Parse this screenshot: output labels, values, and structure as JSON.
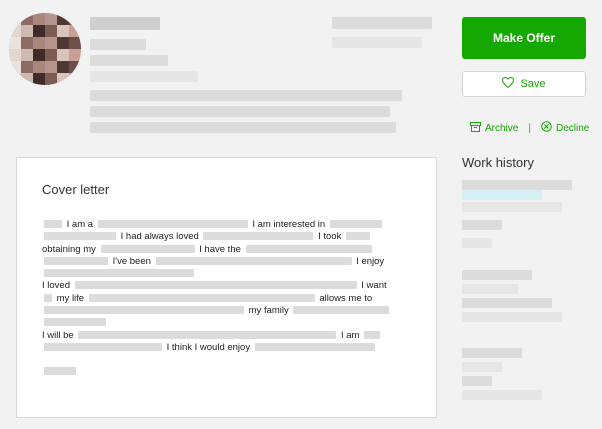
{
  "actions": {
    "make_offer_label": "Make Offer",
    "save_label": "Save",
    "archive_label": "Archive",
    "decline_label": "Decline",
    "separator": "|"
  },
  "work_history": {
    "title": "Work history"
  },
  "cover_letter": {
    "title": "Cover letter",
    "fragments": {
      "i_am_a": "I am a",
      "interested_in": "I am interested in",
      "had_always_loved": "I had always loved",
      "i_took": "I took",
      "obtaining_my": "obtaining my",
      "i_have_the": "I have the",
      "ive_been": "I've been",
      "i_enjoy": "I enjoy",
      "i_loved": "I loved",
      "i_want": "I want",
      "my_life": "my life",
      "allows_me_to": "allows me to",
      "my_family": "my family",
      "i_will_be": "I will be",
      "i_am": "I am",
      "would_enjoy": "I think I would enjoy"
    }
  },
  "colors": {
    "brand_green": "#14a800",
    "page_bg": "#f2f2f2",
    "card_bg": "#ffffff",
    "highlight": "#d6f0f6"
  },
  "icons": {
    "save": "heart-outline-icon",
    "archive": "archive-box-icon",
    "decline": "x-circle-icon"
  }
}
